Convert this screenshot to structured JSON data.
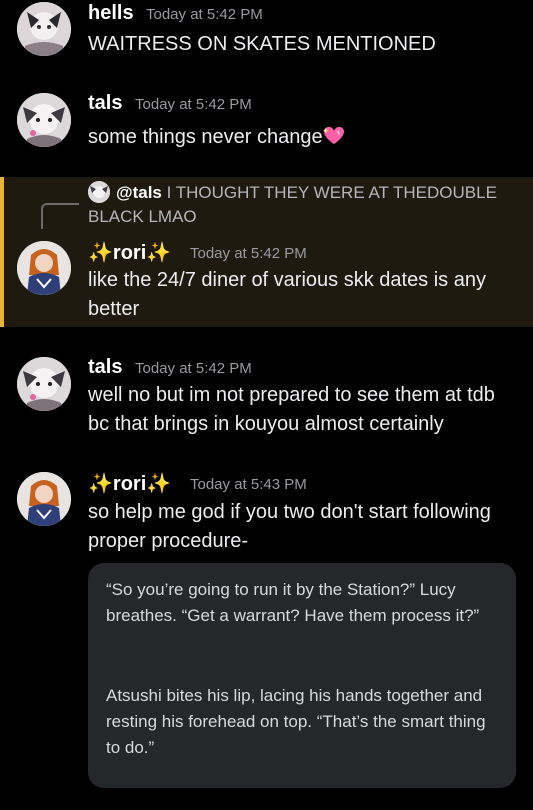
{
  "messages": [
    {
      "name": "hells",
      "timestamp": "Today at 5:42 PM",
      "text": "WAITRESS ON SKATES MENTIONED"
    },
    {
      "name": "tals",
      "timestamp": "Today at 5:42 PM",
      "text": "some things never change"
    },
    {
      "name": "rori",
      "timestamp": "Today at 5:42 PM",
      "reply": {
        "mention": "@tals",
        "text": "I THOUGHT THEY WERE AT THEDOUBLE BLACK LMAO"
      },
      "text": "like the 24/7 diner of various skk dates is any better"
    },
    {
      "name": "tals",
      "timestamp": "Today at 5:42 PM",
      "text": "well no but im not prepared to see them at tdb bc that brings in kouyou almost certainly"
    },
    {
      "name": "rori",
      "timestamp": "Today at 5:43 PM",
      "text": "so help me god if you two don't start following proper procedure-"
    }
  ],
  "name_decoration": "✨",
  "quote": {
    "para1": "“So you’re going to run it by the Station?” Lucy breathes. “Get a warrant? Have them process it?”",
    "para2": "Atsushi bites his lip, lacing his hands together and resting his forehead on top. “That’s the smart thing to do.”"
  },
  "colors": {
    "highlight_border": "#e9b23b",
    "highlight_bg": "#1e1a10",
    "sparkle": "#f6cf3a",
    "heart": "#ff5fa8"
  },
  "icons": {
    "heart": "sparkling-heart-icon",
    "sparkles": "sparkles-icon"
  }
}
